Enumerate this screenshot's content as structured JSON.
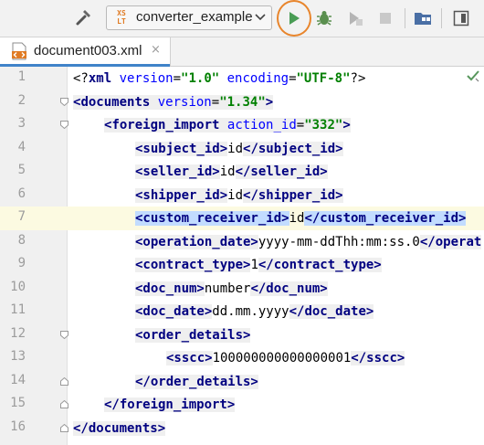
{
  "toolbar": {
    "run_config_name": "converter_example",
    "xslt_icon_text_top": "XS",
    "xslt_icon_text_bottom": "LT",
    "buttons": [
      "build-icon",
      "run-icon",
      "debug-icon",
      "run-coverage-icon",
      "stop-icon",
      "project-structure-icon",
      "layout-icon"
    ]
  },
  "tab": {
    "file_name": "document003.xml",
    "close": "×"
  },
  "editor": {
    "current_line": 7,
    "line_numbers": [
      "1",
      "2",
      "3",
      "4",
      "5",
      "6",
      "7",
      "8",
      "9",
      "10",
      "11",
      "12",
      "13",
      "14",
      "15",
      "16"
    ],
    "colors": {
      "tag": "#000080",
      "attr": "#0000ff",
      "string": "#008000",
      "selection": "#c2dcff",
      "current_line": "#fcfae1"
    }
  },
  "code": {
    "l1": {
      "a": "<?",
      "b": "xml ",
      "c": "version",
      "d": "=",
      "e": "\"1.0\"",
      "f": " ",
      "g": "encoding",
      "h": "=",
      "i": "\"UTF-8\"",
      "j": "?>"
    },
    "l2": {
      "open": "<",
      "tag": "documents",
      "sp": " ",
      "attr": "version",
      "eq": "=",
      "val": "\"1.34\"",
      "close": ">"
    },
    "l3": {
      "open": "<",
      "tag": "foreign_import",
      "sp": " ",
      "attr": "action_id",
      "eq": "=",
      "val": "\"332\"",
      "close": ">"
    },
    "l4": {
      "ot": "<subject_id>",
      "txt": "id",
      "ct": "</subject_id>"
    },
    "l5": {
      "ot": "<seller_id>",
      "txt": "id",
      "ct": "</seller_id>"
    },
    "l6": {
      "ot": "<shipper_id>",
      "txt": "id",
      "ct": "</shipper_id>"
    },
    "l7": {
      "ot": "<custom_receiver_id>",
      "txt": "id",
      "ct": "</custom_receiver_id>"
    },
    "l8": {
      "ot": "<operation_date>",
      "txt": "yyyy-mm-ddThh:mm:ss.0",
      "ct": "</operat"
    },
    "l9": {
      "ot": "<contract_type>",
      "txt": "1",
      "ct": "</contract_type>"
    },
    "l10": {
      "ot": "<doc_num>",
      "txt": "number",
      "ct": "</doc_num>"
    },
    "l11": {
      "ot": "<doc_date>",
      "txt": "dd.mm.yyyy",
      "ct": "</doc_date>"
    },
    "l12": {
      "ot": "<order_details>"
    },
    "l13": {
      "ot": "<sscc>",
      "txt": "100000000000000001",
      "ct": "</sscc>"
    },
    "l14": {
      "ct": "</order_details>"
    },
    "l15": {
      "ct": "</foreign_import>"
    },
    "l16": {
      "ct": "</documents>"
    }
  }
}
